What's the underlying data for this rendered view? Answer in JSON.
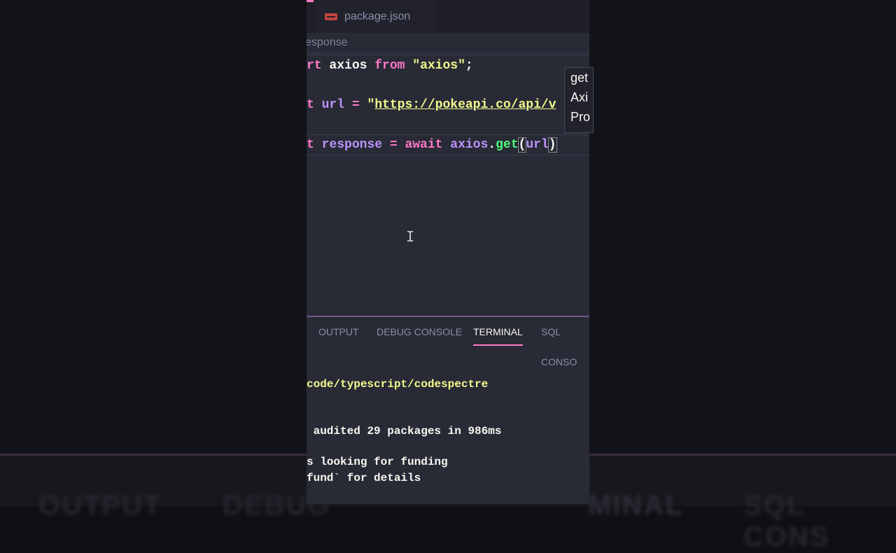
{
  "tabs": {
    "file": "package.json"
  },
  "breadcrumb": "esponse",
  "code": {
    "line1": {
      "kw": "rt",
      "ident": " axios ",
      "from": "from",
      "sp": " ",
      "str": "\"axios\"",
      "end": ";"
    },
    "line2": {
      "kw": "t",
      "sp": " ",
      "var": "url",
      "eq": " = ",
      "q": "\"",
      "url": "https://pokeapi.co/api/v"
    },
    "line3": {
      "kw": "t",
      "sp": " ",
      "var": "response",
      "eq": " = ",
      "await": "await",
      "sp2": " ",
      "obj": "axios",
      "dot": ".",
      "fn": "get",
      "open": "(",
      "arg": "url",
      "close": ")"
    }
  },
  "hover": [
    "get",
    "Axi",
    "Pro"
  ],
  "cursor": "I",
  "terminal": {
    "tabs": [
      "OUTPUT",
      "DEBUG CONSOLE",
      "TERMINAL",
      "SQL CONSO"
    ],
    "active": "TERMINAL",
    "lines": [
      "code/typescript/codespectre",
      " audited 29 packages in 986ms",
      "s looking for funding",
      "fund` for details"
    ]
  },
  "background": {
    "words": [
      "OUTPUT",
      "DEBUG",
      "MINAL",
      "SQL CONS"
    ]
  },
  "colors": {
    "accent": "#ff79c6",
    "background": "#282a36",
    "string": "#f1fa8c",
    "function": "#50fa7b",
    "variable": "#bd93f9"
  }
}
